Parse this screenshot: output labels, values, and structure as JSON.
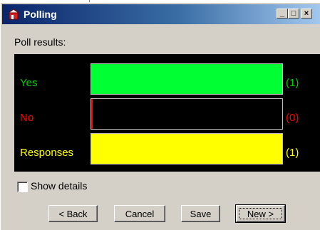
{
  "window": {
    "title": "Polling",
    "controls": {
      "minimize": "_",
      "maximize": "□",
      "close": "×"
    }
  },
  "poll_results_label": "Poll results:",
  "results": [
    {
      "label": "Yes",
      "count": "(1)",
      "fraction": 1.0,
      "label_color": "#00cc00",
      "fill_color": "#00ff33"
    },
    {
      "label": "No",
      "count": "(0)",
      "fraction": 0.0,
      "label_color": "#ff0000",
      "fill_color": "#ff0000"
    },
    {
      "label": "Responses",
      "count": "(1)",
      "fraction": 1.0,
      "label_color": "#ffff00",
      "fill_color": "#ffff00"
    }
  ],
  "show_details": {
    "label": "Show details",
    "checked": false
  },
  "buttons": {
    "back": "< Back",
    "cancel": "Cancel",
    "save": "Save",
    "new": "New >"
  }
}
